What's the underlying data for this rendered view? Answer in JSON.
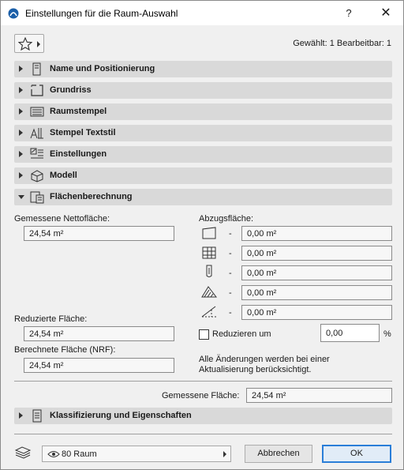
{
  "window": {
    "title": "Einstellungen für die Raum-Auswahl",
    "help_label": "?",
    "close_label": "✕"
  },
  "toolbar": {
    "favorites_icon": "star-icon",
    "selection_info": "Gewählt: 1 Bearbeitbar: 1"
  },
  "sections": [
    {
      "label": "Name und Positionierung",
      "icon": "name-position-icon",
      "expanded": false
    },
    {
      "label": "Grundriss",
      "icon": "floorplan-icon",
      "expanded": false
    },
    {
      "label": "Raumstempel",
      "icon": "zone-stamp-icon",
      "expanded": false
    },
    {
      "label": "Stempel Textstil",
      "icon": "text-style-icon",
      "expanded": false
    },
    {
      "label": "Einstellungen",
      "icon": "settings-icon",
      "expanded": false
    },
    {
      "label": "Modell",
      "icon": "model-icon",
      "expanded": false
    },
    {
      "label": "Flächenberechnung",
      "icon": "area-calc-icon",
      "expanded": true
    }
  ],
  "area": {
    "measured_net_label": "Gemessene Nettofläche:",
    "measured_net_value": "24,54 m²",
    "deductions_label": "Abzugsfläche:",
    "deductions": [
      {
        "icon": "low-height-icon",
        "dash": "-",
        "value": "0,00 m²"
      },
      {
        "icon": "wall-inset-icon",
        "dash": "-",
        "value": "0,00 m²"
      },
      {
        "icon": "column-icon",
        "dash": "-",
        "value": "0,00 m²"
      },
      {
        "icon": "hatch-icon",
        "dash": "-",
        "value": "0,00 m²"
      },
      {
        "icon": "roof-icon",
        "dash": "-",
        "value": "0,00 m²"
      }
    ],
    "reduced_label": "Reduzierte Fläche:",
    "reduced_value": "24,54 m²",
    "reduce_checkbox_label": "Reduzieren um",
    "reduce_checked": false,
    "reduce_value": "0,00",
    "reduce_unit": "%",
    "calculated_label": "Berechnete Fläche (NRF):",
    "calculated_value": "24,54 m²",
    "note": "Alle Änderungen werden bei einer Aktualisierung berücksichtigt.",
    "measured_area_label": "Gemessene Fläche:",
    "measured_area_value": "24,54 m²"
  },
  "classification": {
    "label": "Klassifizierung und Eigenschaften",
    "icon": "classification-icon",
    "expanded": false
  },
  "footer": {
    "layer_icon": "layers-icon",
    "layer_value": "80 Raum",
    "cancel_label": "Abbrechen",
    "ok_label": "OK"
  }
}
